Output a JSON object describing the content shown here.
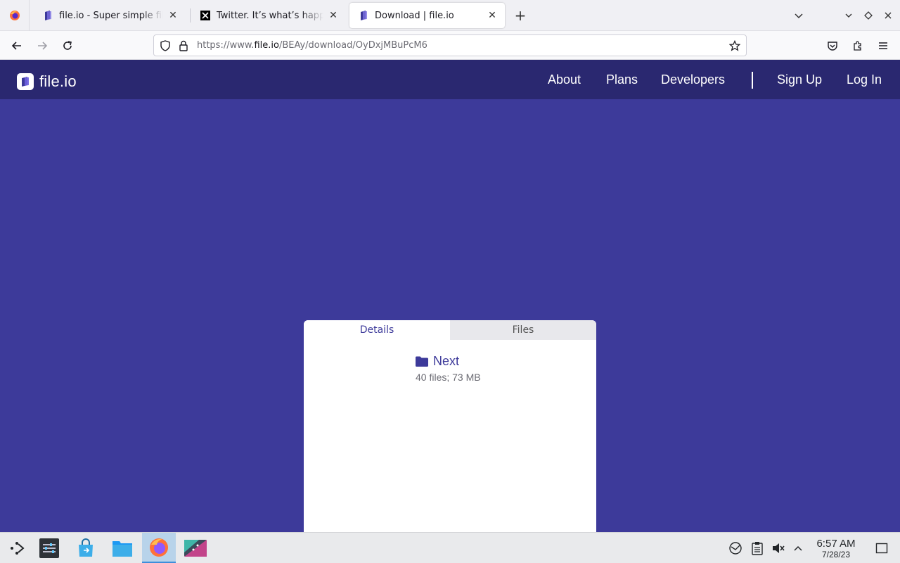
{
  "browser": {
    "tabs": [
      {
        "title": "file.io - Super simple file sharing!",
        "favicon": "fileio-logo-icon"
      },
      {
        "title": "Twitter. It’s what’s happening / Twitter",
        "favicon": "x-logo-icon"
      },
      {
        "title": "Download | file.io",
        "favicon": "fileio-logo-icon",
        "active": true
      }
    ],
    "url": {
      "prefix": "https://www.",
      "domain": "file.io",
      "path": "/BEAy/download/OyDxjMBuPcM6"
    }
  },
  "site": {
    "brand": "file.io",
    "nav": [
      "About",
      "Plans",
      "Developers",
      "Sign Up",
      "Log In"
    ],
    "colors": {
      "header": "#2a2870",
      "background": "#3d3a9a",
      "accent": "#3d3a9a"
    }
  },
  "card": {
    "tabs": [
      "Details",
      "Files"
    ],
    "active_tab": "Details",
    "folder_name": "Next",
    "folder_meta": "40 files; 73 MB"
  },
  "taskbar": {
    "time": "6:57 AM",
    "date": "7/28/23"
  }
}
